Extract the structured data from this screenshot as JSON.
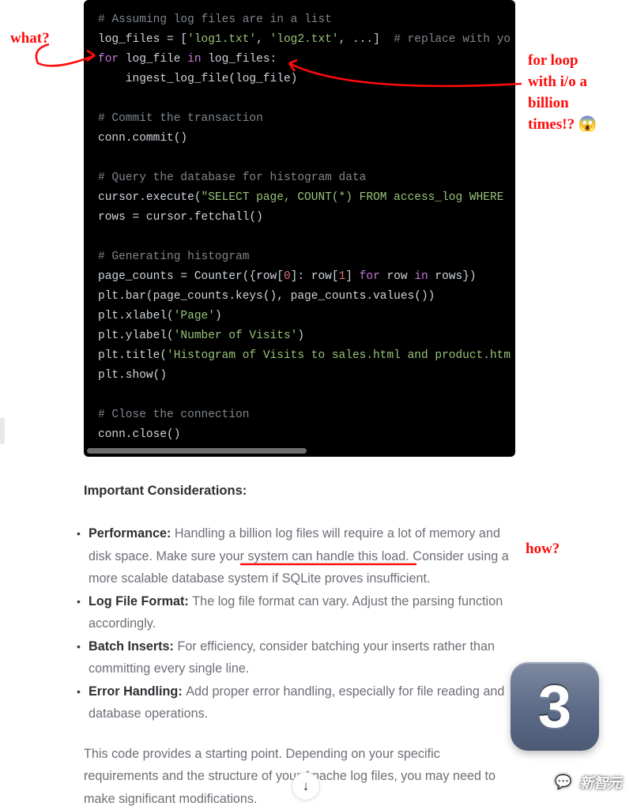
{
  "annotations": {
    "what": "what?",
    "forloop_line1": "for loop",
    "forloop_line2": "with i/o a",
    "forloop_line3": "billion",
    "forloop_line4": "times!?",
    "scream_emoji": "😱",
    "how": "how?"
  },
  "code": {
    "c_assume": "# Assuming log files are in a list",
    "logfiles_pre": "log_files = [",
    "logfiles_s1": "'log1.txt'",
    "logfiles_comma": ", ",
    "logfiles_s2": "'log2.txt'",
    "logfiles_post": ", ...]  ",
    "logfiles_cmt": "# replace with yo",
    "for_kw": "for",
    "for_mid": " log_file ",
    "in_kw": "in",
    "for_tail": " log_files:",
    "ingest": "    ingest_log_file(log_file)",
    "c_commit": "# Commit the transaction",
    "commit": "conn.commit()",
    "c_query": "# Query the database for histogram data",
    "exec_pre": "cursor.execute(",
    "exec_str": "\"SELECT page, COUNT(*) FROM access_log WHERE ",
    "fetchall": "rows = cursor.fetchall()",
    "c_hist": "# Generating histogram",
    "pc_pre": "page_counts = Counter({row[",
    "pc_zero": "0",
    "pc_mid1": "]: row[",
    "pc_one": "1",
    "pc_mid2": "] ",
    "pc_for": "for",
    "pc_row": " row ",
    "pc_in": "in",
    "pc_tail": " rows})",
    "pltbar": "plt.bar(page_counts.keys(), page_counts.values())",
    "pltx_pre": "plt.xlabel(",
    "pltx_str": "'Page'",
    "pltx_post": ")",
    "plty_pre": "plt.ylabel(",
    "plty_str": "'Number of Visits'",
    "plty_post": ")",
    "pltt_pre": "plt.title(",
    "pltt_str": "'Histogram of Visits to sales.html and product.htm",
    "pltshow": "plt.show()",
    "c_close": "# Close the connection",
    "connclose": "conn.close()"
  },
  "text": {
    "heading": "Important Considerations:",
    "perf_b": "Performance: ",
    "perf_1": "Handling a billion log files will require a lot of memory and disk space. ",
    "perf_u": "Make sure your system can handle this load.",
    "perf_2": " Consider using a more scalable database system if SQLite proves insufficient.",
    "logfmt_b": "Log File Format: ",
    "logfmt": "The log file format can vary. Adjust the parsing function accordingly.",
    "batch_b": "Batch Inserts: ",
    "batch": "For efficiency, consider batching your inserts rather than committing every single line.",
    "err_b": "Error Handling: ",
    "err": "Add proper error handling, especially for file reading and database operations.",
    "closing": "This code provides a starting point. Depending on your specific requirements and the structure of your Apache log files, you may need to make significant modifications."
  },
  "ui": {
    "scroll_arrow": "↓",
    "badge_value": "3",
    "watermark_icon": "💬",
    "watermark_text": "新智元"
  }
}
